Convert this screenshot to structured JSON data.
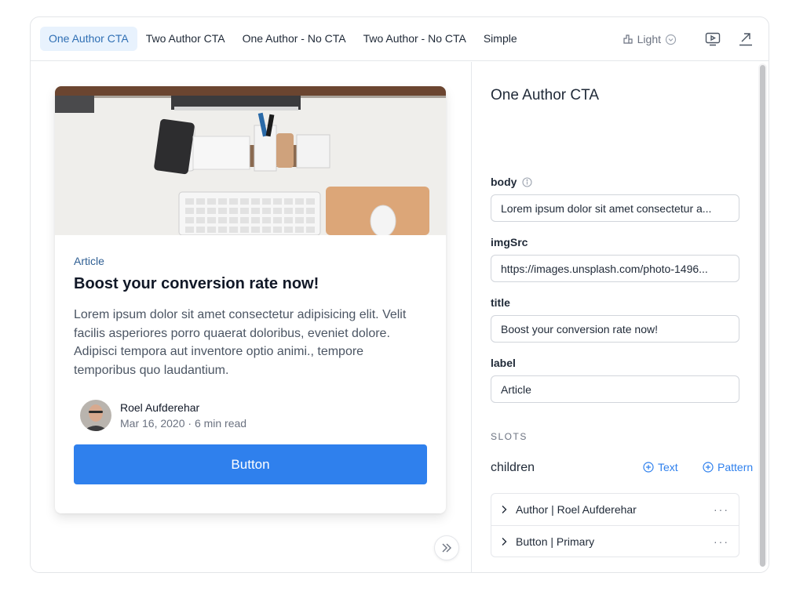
{
  "tabs": [
    {
      "label": "One Author CTA",
      "active": true
    },
    {
      "label": "Two Author CTA",
      "active": false
    },
    {
      "label": "One Author - No CTA",
      "active": false
    },
    {
      "label": "Two Author - No CTA",
      "active": false
    },
    {
      "label": "Simple",
      "active": false
    }
  ],
  "toolbar": {
    "theme_label": "Light",
    "icons": [
      "theme-icon",
      "chevron-down-circle-icon",
      "play-icon",
      "external-link-icon"
    ]
  },
  "card": {
    "image_description_icon": "desk-photo",
    "label": "Article",
    "title": "Boost your conversion rate now!",
    "body": "Lorem ipsum dolor sit amet consectetur adipisicing elit. Velit facilis asperiores porro quaerat doloribus, eveniet dolore. Adipisci tempora aut inventore optio animi., tempore temporibus quo laudantium.",
    "author_name": "Roel Aufderehar",
    "author_meta": "Mar 16, 2020 · 6 min read",
    "button_label": "Button"
  },
  "panel": {
    "title": "One Author CTA",
    "fields": {
      "body": {
        "label": "body",
        "value": "Lorem ipsum dolor sit amet consectetur a..."
      },
      "imgSrc": {
        "label": "imgSrc",
        "value": "https://images.unsplash.com/photo-1496..."
      },
      "title": {
        "label": "title",
        "value": "Boost your conversion rate now!"
      },
      "label": {
        "label": "label",
        "value": "Article"
      }
    },
    "slots_heading": "SLOTS",
    "children_label": "children",
    "add_text_label": "Text",
    "add_pattern_label": "Pattern",
    "slot_items": [
      {
        "label": "Author | Roel Aufderehar",
        "more": "···"
      },
      {
        "label": "Button | Primary",
        "more": "···"
      }
    ]
  },
  "colors": {
    "accent": "#2f80ed",
    "active_tab_bg": "#e8f2fd",
    "label_blue": "#2f5f93"
  }
}
